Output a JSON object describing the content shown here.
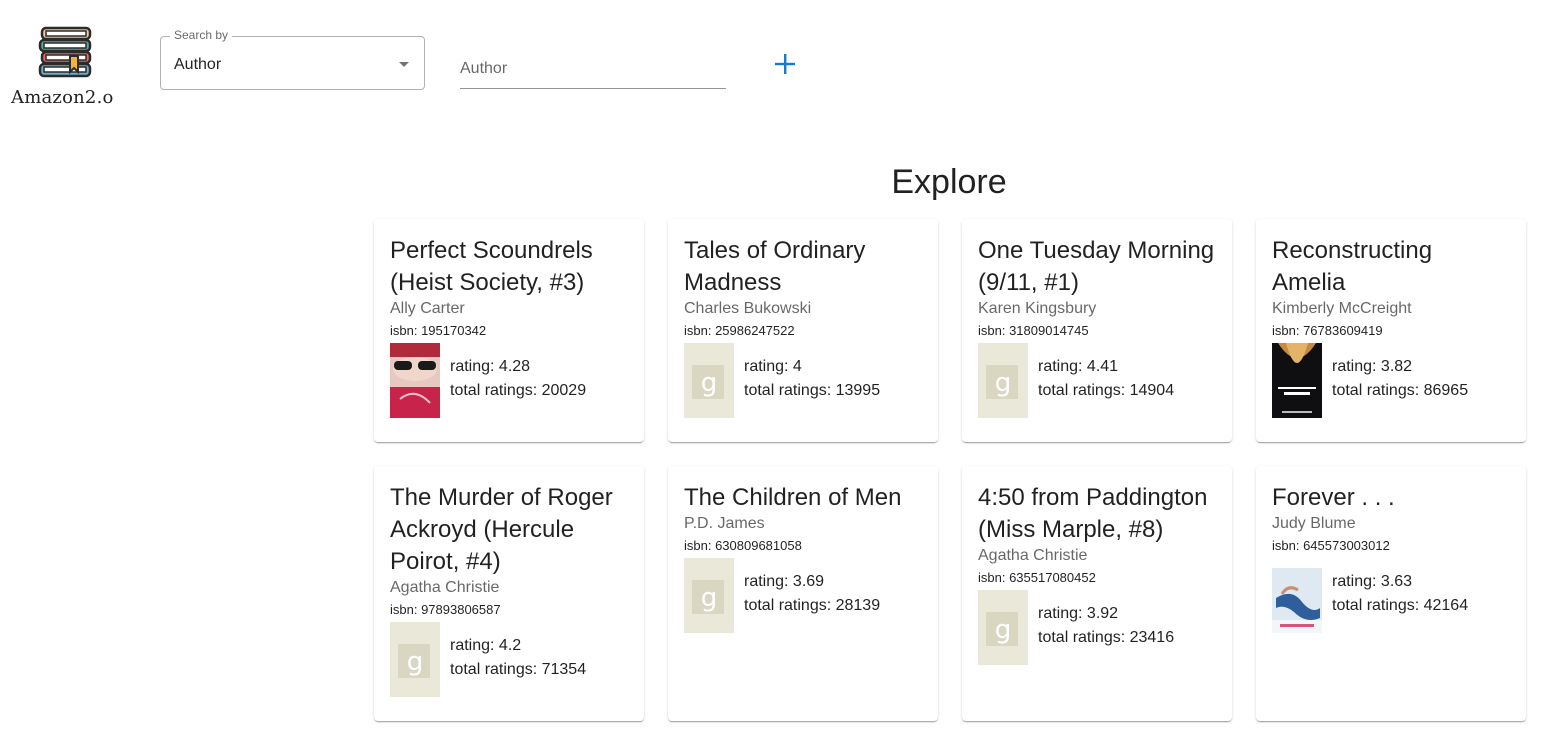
{
  "app": {
    "logo_text": "Amazon2.o"
  },
  "search": {
    "label": "Search by",
    "selected": "Author",
    "placeholder": "Author"
  },
  "colors": {
    "accent": "#1976d2",
    "placeholder_cover": "#e9e8d9"
  },
  "icons": {
    "add": "plus-icon",
    "select": "caret-down-icon",
    "logo": "books-icon"
  },
  "explore": {
    "title": "Explore",
    "books": [
      {
        "title": "Perfect Scoundrels (Heist Society, #3)",
        "author": "Ally Carter",
        "isbn": "isbn: 195170342",
        "rating": "rating: 4.28",
        "total": "total ratings: 20029",
        "cover": "photo"
      },
      {
        "title": "Tales of Ordinary Madness",
        "author": "Charles Bukowski",
        "isbn": "isbn: 25986247522",
        "rating": "rating: 4",
        "total": "total ratings: 13995",
        "cover": "placeholder"
      },
      {
        "title": "One Tuesday Morning (9/11, #1)",
        "author": "Karen Kingsbury",
        "isbn": "isbn: 31809014745",
        "rating": "rating: 4.41",
        "total": "total ratings: 14904",
        "cover": "placeholder"
      },
      {
        "title": "Reconstructing Amelia",
        "author": "Kimberly McCreight",
        "isbn": "isbn: 76783609419",
        "rating": "rating: 3.82",
        "total": "total ratings: 86965",
        "cover": "photo"
      },
      {
        "title": "The Murder of Roger Ackroyd (Hercule Poirot, #4)",
        "author": "Agatha Christie",
        "isbn": "isbn: 97893806587",
        "rating": "rating: 4.2",
        "total": "total ratings: 71354",
        "cover": "placeholder"
      },
      {
        "title": "The Children of Men",
        "author": "P.D. James",
        "isbn": "isbn: 630809681058",
        "rating": "rating: 3.69",
        "total": "total ratings: 28139",
        "cover": "placeholder"
      },
      {
        "title": "4:50 from Paddington (Miss Marple, #8)",
        "author": "Agatha Christie",
        "isbn": "isbn: 635517080452",
        "rating": "rating: 3.92",
        "total": "total ratings: 23416",
        "cover": "placeholder"
      },
      {
        "title": "Forever . . .",
        "author": "Judy Blume",
        "isbn": "isbn: 645573003012",
        "rating": "rating: 3.63",
        "total": "total ratings: 42164",
        "cover": "photo"
      }
    ]
  }
}
